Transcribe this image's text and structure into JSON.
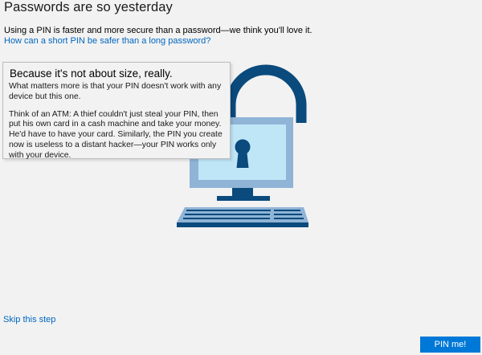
{
  "header": {
    "title": "Passwords are so yesterday",
    "subtitle": "Using a PIN is faster and more secure than a password—we think you'll love it.",
    "why_link": "How can a short PIN be safer than a long password?"
  },
  "tooltip": {
    "heading": "Because it's not about size, really.",
    "paragraph1": "What matters more is that your PIN doesn't work with any device but this one.",
    "paragraph2": "Think of an ATM: A thief couldn't just steal your PIN, then put his own card in a cash machine and take your money. He'd have to have your card. Similarly, the PIN you create now is useless to a distant hacker—your PIN works only with your device."
  },
  "footer": {
    "skip_link": "Skip this step",
    "primary_button": "PIN me!"
  },
  "colors": {
    "background": "#f2f2f2",
    "accent": "#0078d7",
    "link": "#0067c0",
    "illustration_dark": "#0a4a7c",
    "illustration_mid": "#8fb4d6",
    "illustration_light": "#bfe6f7"
  },
  "illustration": "padlock-computer-illustration"
}
